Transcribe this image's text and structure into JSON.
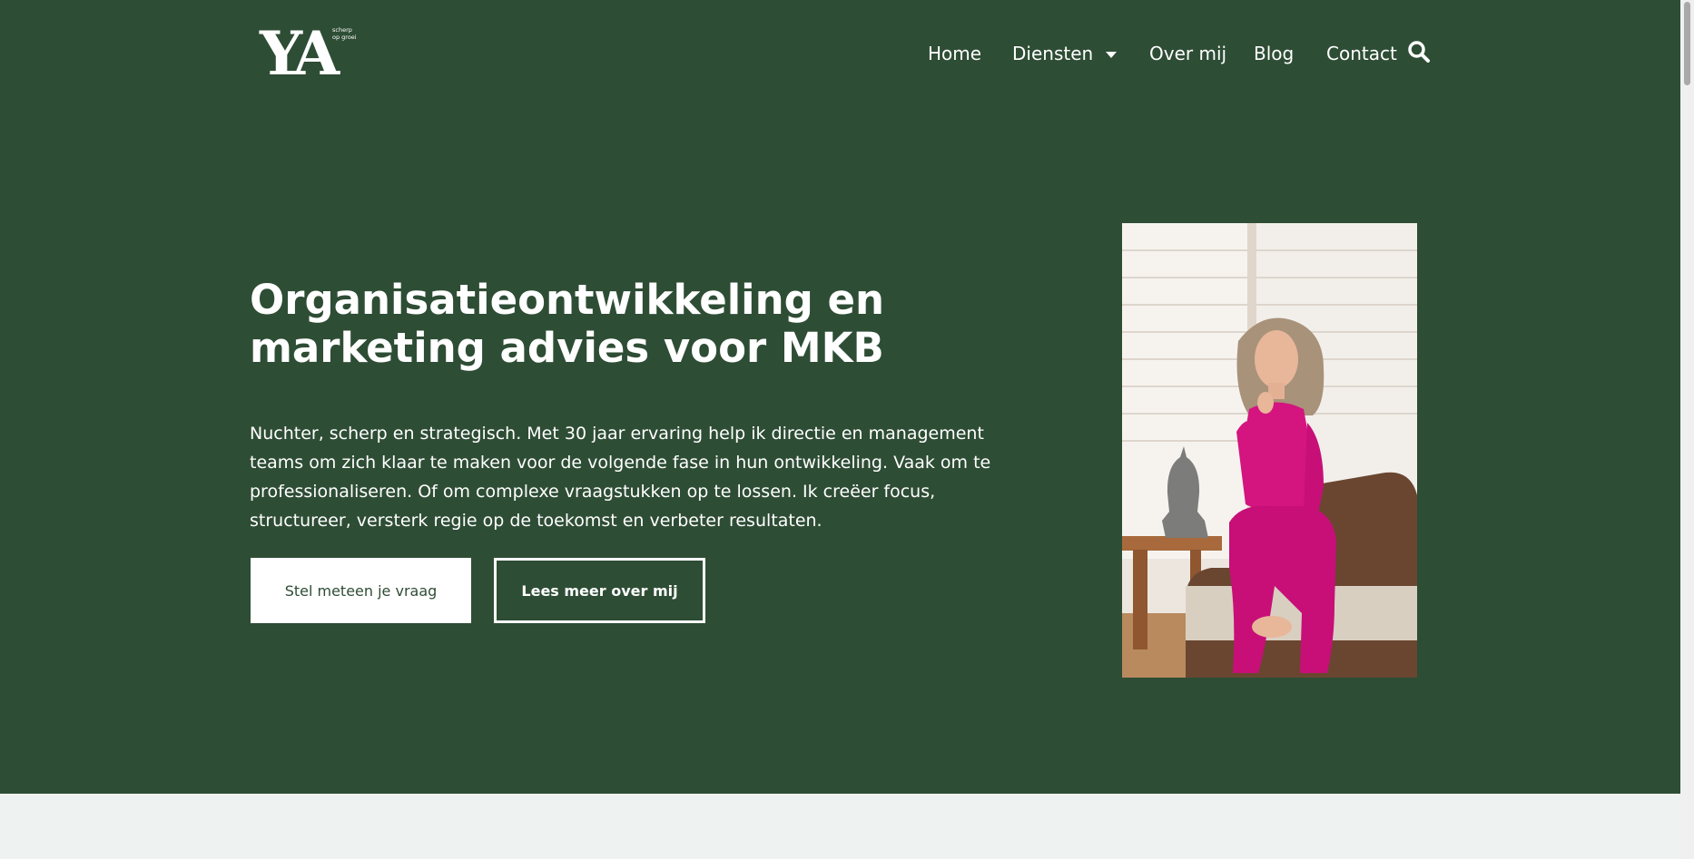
{
  "brand": {
    "mark": "YA",
    "tagline": "scherp\nop groei"
  },
  "nav": {
    "items": [
      {
        "label": "Home"
      },
      {
        "label": "Diensten",
        "has_dropdown": true
      },
      {
        "label": "Over mij"
      },
      {
        "label": "Blog"
      },
      {
        "label": "Contact"
      }
    ],
    "search_icon": "search-icon"
  },
  "hero": {
    "title": "Organisatieontwikkeling en marketing advies voor MKB",
    "intro": "Nuchter, scherp en strategisch. Met 30 jaar ervaring help ik directie en management teams om zich klaar te maken voor de volgende fase in hun ontwikkeling. Vaak om te professionaliseren. Of om complexe vraagstukken op te lossen. Ik creëer focus, structureer, versterk regie op de toekomst en verbeter resultaten.",
    "primary_button": "Stel meteen je vraag",
    "secondary_button": "Lees meer over mij"
  },
  "colors": {
    "hero_background": "#2e4d35",
    "text": "#ffffff",
    "below_fold": "#eef3f1",
    "accent_pink": "#d4147f"
  }
}
